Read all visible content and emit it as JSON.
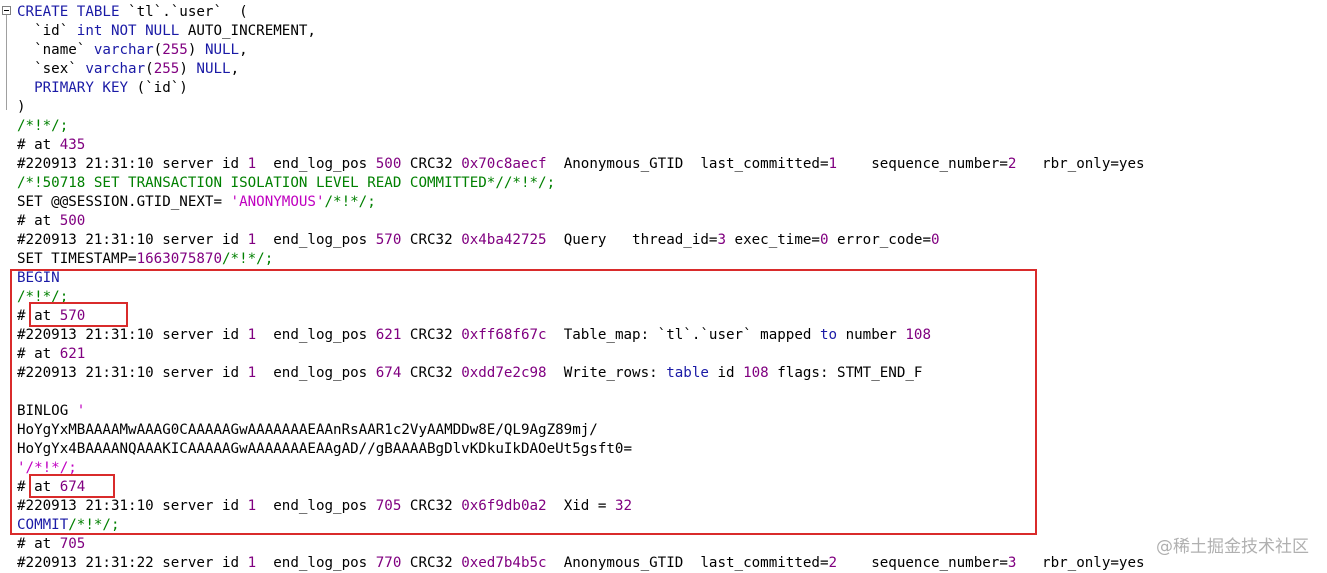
{
  "colors": {
    "keyword": "#1a1aa6",
    "comment": "#008000",
    "number": "#800080",
    "string": "#c000c0",
    "highlight_box": "#d92b2b"
  },
  "watermark": "@稀土掘金技术社区",
  "lines": [
    [
      [
        "kw",
        "CREATE TABLE "
      ],
      [
        "blk",
        "`tl`.`user`  ("
      ]
    ],
    [
      [
        "blk",
        "  `id` "
      ],
      [
        "kw",
        "int NOT NULL "
      ],
      [
        "blk",
        "AUTO_INCREMENT,"
      ]
    ],
    [
      [
        "blk",
        "  `name` "
      ],
      [
        "kw",
        "varchar"
      ],
      [
        "blk",
        "("
      ],
      [
        "num",
        "255"
      ],
      [
        "blk",
        ") "
      ],
      [
        "kw",
        "NULL"
      ],
      [
        "blk",
        ","
      ]
    ],
    [
      [
        "blk",
        "  `sex` "
      ],
      [
        "kw",
        "varchar"
      ],
      [
        "blk",
        "("
      ],
      [
        "num",
        "255"
      ],
      [
        "blk",
        ") "
      ],
      [
        "kw",
        "NULL"
      ],
      [
        "blk",
        ","
      ]
    ],
    [
      [
        "kw",
        "  PRIMARY KEY "
      ],
      [
        "blk",
        "(`id`)"
      ]
    ],
    [
      [
        "blk",
        ")"
      ]
    ],
    [
      [
        "cm",
        "/*!*/;"
      ]
    ],
    [
      [
        "blk",
        "# at "
      ],
      [
        "num",
        "435"
      ]
    ],
    [
      [
        "blk",
        "#220913 21:31:10 server id "
      ],
      [
        "num",
        "1"
      ],
      [
        "blk",
        "  end_log_pos "
      ],
      [
        "num",
        "500"
      ],
      [
        "blk",
        " CRC32 "
      ],
      [
        "num",
        "0x70c8aecf"
      ],
      [
        "blk",
        "  Anonymous_GTID  last_committed="
      ],
      [
        "num",
        "1"
      ],
      [
        "blk",
        "    sequence_number="
      ],
      [
        "num",
        "2"
      ],
      [
        "blk",
        "   rbr_only=yes"
      ]
    ],
    [
      [
        "cm",
        "/*!50718 SET TRANSACTION ISOLATION LEVEL READ COMMITTED*//*!*/;"
      ]
    ],
    [
      [
        "blk",
        "SET @@SESSION.GTID_NEXT= "
      ],
      [
        "str",
        "'ANONYMOUS'"
      ],
      [
        "cm",
        "/*!*/;"
      ]
    ],
    [
      [
        "blk",
        "# at "
      ],
      [
        "num",
        "500"
      ]
    ],
    [
      [
        "blk",
        "#220913 21:31:10 server id "
      ],
      [
        "num",
        "1"
      ],
      [
        "blk",
        "  end_log_pos "
      ],
      [
        "num",
        "570"
      ],
      [
        "blk",
        " CRC32 "
      ],
      [
        "num",
        "0x4ba42725"
      ],
      [
        "blk",
        "  Query   thread_id="
      ],
      [
        "num",
        "3"
      ],
      [
        "blk",
        " exec_time="
      ],
      [
        "num",
        "0"
      ],
      [
        "blk",
        " error_code="
      ],
      [
        "num",
        "0"
      ]
    ],
    [
      [
        "blk",
        "SET TIMESTAMP="
      ],
      [
        "num",
        "1663075870"
      ],
      [
        "cm",
        "/*!*/;"
      ]
    ],
    [
      [
        "kw",
        "BEGIN"
      ]
    ],
    [
      [
        "cm",
        "/*!*/;"
      ]
    ],
    [
      [
        "blk",
        "# at "
      ],
      [
        "num",
        "570"
      ]
    ],
    [
      [
        "blk",
        "#220913 21:31:10 server id "
      ],
      [
        "num",
        "1"
      ],
      [
        "blk",
        "  end_log_pos "
      ],
      [
        "num",
        "621"
      ],
      [
        "blk",
        " CRC32 "
      ],
      [
        "num",
        "0xff68f67c"
      ],
      [
        "blk",
        "  Table_map: `tl`.`user` mapped "
      ],
      [
        "kw",
        "to"
      ],
      [
        "blk",
        " number "
      ],
      [
        "num",
        "108"
      ]
    ],
    [
      [
        "blk",
        "# at "
      ],
      [
        "num",
        "621"
      ]
    ],
    [
      [
        "blk",
        "#220913 21:31:10 server id "
      ],
      [
        "num",
        "1"
      ],
      [
        "blk",
        "  end_log_pos "
      ],
      [
        "num",
        "674"
      ],
      [
        "blk",
        " CRC32 "
      ],
      [
        "num",
        "0xdd7e2c98"
      ],
      [
        "blk",
        "  Write_rows: "
      ],
      [
        "kw",
        "table"
      ],
      [
        "blk",
        " id "
      ],
      [
        "num",
        "108"
      ],
      [
        "blk",
        " flags: STMT_END_F"
      ]
    ],
    [
      [
        "blk",
        " "
      ]
    ],
    [
      [
        "blk",
        "BINLOG "
      ],
      [
        "str",
        "'"
      ]
    ],
    [
      [
        "blk",
        "HoYgYxMBAAAAMwAAAG0CAAAAAGwAAAAAAAEAAnRsAAR1c2VyAAMDDw8E/QL9AgZ89mj/"
      ]
    ],
    [
      [
        "blk",
        "HoYgYx4BAAAANQAAAKICAAAAAGwAAAAAAAEAAgAD//gBAAAABgDlvKDkuIkDAOeUt5gsft0="
      ]
    ],
    [
      [
        "str",
        "'/*!*/;"
      ]
    ],
    [
      [
        "blk",
        "# at "
      ],
      [
        "num",
        "674"
      ]
    ],
    [
      [
        "blk",
        "#220913 21:31:10 server id "
      ],
      [
        "num",
        "1"
      ],
      [
        "blk",
        "  end_log_pos "
      ],
      [
        "num",
        "705"
      ],
      [
        "blk",
        " CRC32 "
      ],
      [
        "num",
        "0x6f9db0a2"
      ],
      [
        "blk",
        "  Xid = "
      ],
      [
        "num",
        "32"
      ]
    ],
    [
      [
        "kw",
        "COMMIT"
      ],
      [
        "cm",
        "/*!*/;"
      ]
    ],
    [
      [
        "blk",
        "# at "
      ],
      [
        "num",
        "705"
      ]
    ],
    [
      [
        "blk",
        "#220913 21:31:22 server id "
      ],
      [
        "num",
        "1"
      ],
      [
        "blk",
        "  end_log_pos "
      ],
      [
        "num",
        "770"
      ],
      [
        "blk",
        " CRC32 "
      ],
      [
        "num",
        "0xed7b4b5c"
      ],
      [
        "blk",
        "  Anonymous_GTID  last_committed="
      ],
      [
        "num",
        "2"
      ],
      [
        "blk",
        "    sequence_number="
      ],
      [
        "num",
        "3"
      ],
      [
        "blk",
        "   rbr_only=yes"
      ]
    ]
  ]
}
